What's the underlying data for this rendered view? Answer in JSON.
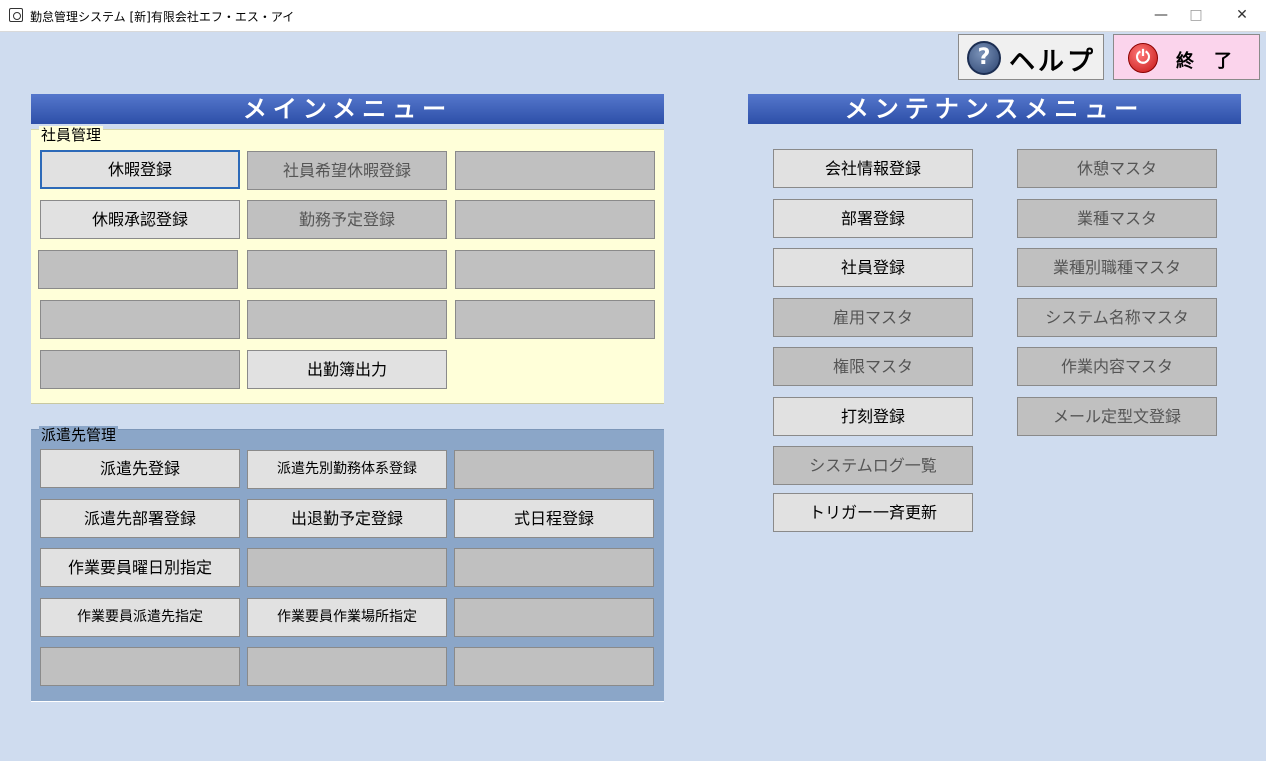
{
  "window": {
    "title": "勤怠管理システム [新]有限会社エフ・エス・アイ",
    "minimize": "—",
    "maximize": "□",
    "close": "✕"
  },
  "toolbar": {
    "help_icon_glyph": "?",
    "help_label": "ヘルプ",
    "exit_icon_glyph": "⏻",
    "exit_label": "終了"
  },
  "main_menu": {
    "title": "メインメニュー",
    "employee_group": {
      "label": "社員管理",
      "buttons": [
        {
          "label": "休暇登録",
          "state": "enabled"
        },
        {
          "label": "社員希望休暇登録",
          "state": "disabled"
        },
        {
          "label": "",
          "state": "empty"
        },
        {
          "label": "休暇承認登録",
          "state": "enabled"
        },
        {
          "label": "勤務予定登録",
          "state": "disabled"
        },
        {
          "label": "",
          "state": "empty"
        },
        {
          "label": "",
          "state": "empty"
        },
        {
          "label": "",
          "state": "empty"
        },
        {
          "label": "",
          "state": "empty"
        },
        {
          "label": "",
          "state": "empty"
        },
        {
          "label": "",
          "state": "empty"
        },
        {
          "label": "",
          "state": "empty"
        },
        {
          "label": "",
          "state": "empty"
        },
        {
          "label": "出勤簿出力",
          "state": "enabled"
        }
      ]
    },
    "dispatch_group": {
      "label": "派遣先管理",
      "buttons": [
        {
          "label": "派遣先登録",
          "state": "enabled"
        },
        {
          "label": "派遣先別勤務体系登録",
          "state": "enabled"
        },
        {
          "label": "",
          "state": "empty"
        },
        {
          "label": "派遣先部署登録",
          "state": "enabled"
        },
        {
          "label": "出退勤予定登録",
          "state": "enabled"
        },
        {
          "label": "式日程登録",
          "state": "enabled"
        },
        {
          "label": "作業要員曜日別指定",
          "state": "enabled"
        },
        {
          "label": "",
          "state": "empty"
        },
        {
          "label": "",
          "state": "empty"
        },
        {
          "label": "作業要員派遣先指定",
          "state": "enabled"
        },
        {
          "label": "作業要員作業場所指定",
          "state": "enabled"
        },
        {
          "label": "",
          "state": "empty"
        },
        {
          "label": "",
          "state": "empty"
        },
        {
          "label": "",
          "state": "empty"
        },
        {
          "label": "",
          "state": "empty"
        }
      ]
    }
  },
  "maintenance_menu": {
    "title": "メンテナンスメニュー",
    "left_buttons": [
      {
        "label": "会社情報登録",
        "state": "enabled"
      },
      {
        "label": "部署登録",
        "state": "enabled"
      },
      {
        "label": "社員登録",
        "state": "enabled"
      },
      {
        "label": "雇用マスタ",
        "state": "disabled"
      },
      {
        "label": "権限マスタ",
        "state": "disabled"
      },
      {
        "label": "打刻登録",
        "state": "enabled"
      },
      {
        "label": "システムログ一覧",
        "state": "disabled"
      },
      {
        "label": "トリガー一斉更新",
        "state": "enabled"
      }
    ],
    "right_buttons": [
      {
        "label": "休憩マスタ",
        "state": "disabled"
      },
      {
        "label": "業種マスタ",
        "state": "disabled"
      },
      {
        "label": "業種別職種マスタ",
        "state": "disabled"
      },
      {
        "label": "システム名称マスタ",
        "state": "disabled"
      },
      {
        "label": "作業内容マスタ",
        "state": "disabled"
      },
      {
        "label": "メール定型文登録",
        "state": "disabled"
      }
    ]
  }
}
